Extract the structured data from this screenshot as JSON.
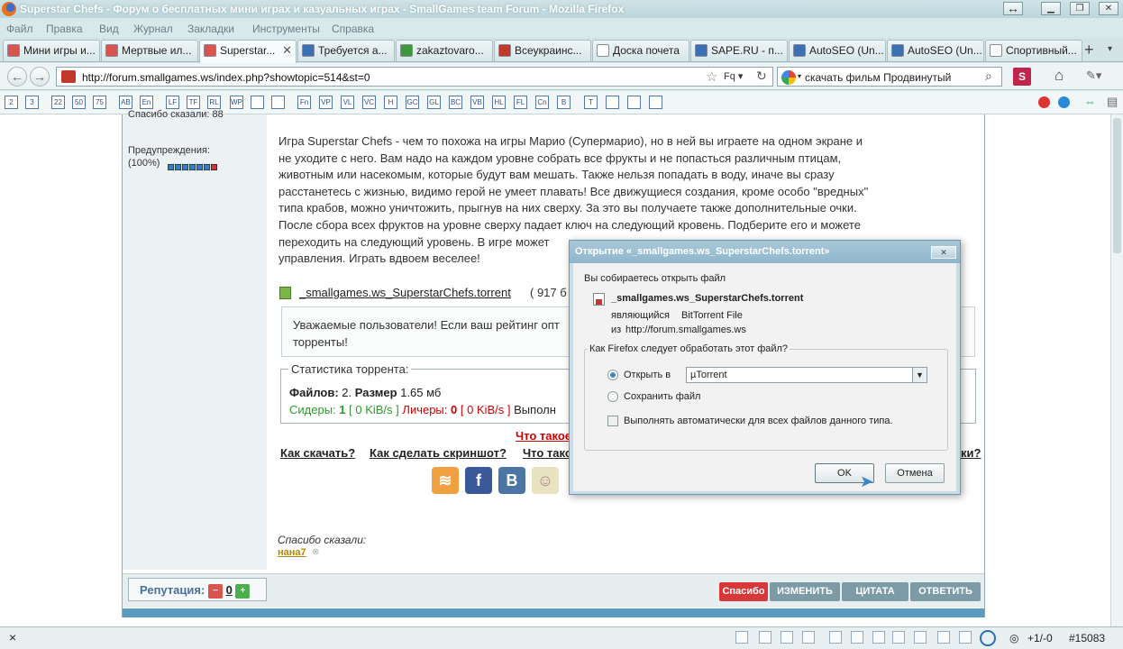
{
  "window": {
    "title": "Superstar Chefs - Форум о бесплатных мини играх и казуальных играх - SmallGames team Forum - Mozilla Firefox"
  },
  "menu": [
    "Файл",
    "Правка",
    "Вид",
    "Журнал",
    "Закладки",
    "Инструменты",
    "Справка"
  ],
  "tabs": [
    {
      "label": "Мини игры и...",
      "color": "#d9534f"
    },
    {
      "label": "Мертвые ил...",
      "color": "#d9534f"
    },
    {
      "label": "Superstar...",
      "color": "#d9534f",
      "active": true
    },
    {
      "label": "Требуется а...",
      "color": "#3b6fb6"
    },
    {
      "label": "zakaztovaro...",
      "color": "#3a9a3a"
    },
    {
      "label": "Всеукраинс...",
      "color": "#c0392b"
    },
    {
      "label": "Доска почета",
      "color": "#ffffff"
    },
    {
      "label": "SAPE.RU - п...",
      "color": "#3b6fb6"
    },
    {
      "label": "AutoSEO (Un...",
      "color": "#3b6fb6"
    },
    {
      "label": "AutoSEO (Un...",
      "color": "#3b6fb6"
    },
    {
      "label": "Спортивный...",
      "color": "#ffffff"
    }
  ],
  "nav": {
    "url": "http://forum.smallgames.ws/index.php?showtopic=514&st=0",
    "search": "скачать фильм Продвинутый"
  },
  "bbcodes": [
    "2",
    "3",
    "22",
    "50",
    "75",
    "AB",
    "En",
    "LF",
    "TF",
    "RL",
    "WP",
    "",
    "",
    "Fn",
    "VP",
    "VL",
    "VC",
    "H",
    "GC",
    "GL",
    "BC",
    "VB",
    "HL",
    "FL",
    "Cn",
    "B",
    "T",
    "",
    "",
    ""
  ],
  "sidebar": {
    "thanks_top": "Спасибо сказали: 88",
    "warn_label": "Предупреждения:",
    "warn_value": "(100%)"
  },
  "post": {
    "lines": [
      "Игра Superstar Chefs - чем то похожа на игры Марио (Супермарио), но в ней вы играете на одном экране и",
      "не уходите с него. Вам надо на каждом уровне собрать все фрукты и не попасться различным птицам,",
      "животным или насекомым, которые будут вам мешать. Также нельзя попадать в воду, иначе вы сразу",
      "расстанетесь с жизнью, видимо герой не умеет плавать! Все движущиеся создания, кроме особо \"вредных\"",
      "типа крабов, можно уничтожить, прыгнув на них сверху. За это вы получаете также дополнительные очки.",
      "После сбора всех фруктов на уровне сверху падает ключ на следующий кровень. Подберите его и можете",
      "переходить на следующий уровень. В игре может",
      "управления. Играть вдвоем веселее!"
    ],
    "attachment": "_smallgames.ws_SuperstarChefs.torrent",
    "attachment_size": "( 917 б",
    "notice_line1": "Уважаемые пользователи! Если ваш рейтинг опт",
    "notice_line2": "торренты!"
  },
  "stats": {
    "legend": "Статистика торрента:",
    "files_label": "Файлов:",
    "files_value": "2.",
    "size_label": "Размер",
    "size_value": "1.65 мб",
    "seeders_label": "Сидеры:",
    "seeders_value": "1",
    "seed_speed": "[ 0 KiB/s ]",
    "leechers_label": "Личеры:",
    "leechers_value": "0",
    "leech_speed": "[ 0 KiB/s ]",
    "extra": "Выполн"
  },
  "links": {
    "what": "Что такое",
    "how_download": "Как скачать?",
    "how_screenshot": "Как сделать скриншот?",
    "what2": "Что тако",
    "tail": "ки?"
  },
  "thanks": {
    "label": "Спасибо сказали:",
    "user": "нана7"
  },
  "footer": {
    "rep_label": "Репутация:",
    "rep_value": "0",
    "btn_thanks": "Спасибо",
    "btn_edit": "ИЗМЕНИТЬ",
    "btn_quote": "ЦИТАТА",
    "btn_reply": "ОТВЕТИТЬ"
  },
  "status": {
    "close": "×",
    "count": "+1/-0",
    "id": "#15083"
  },
  "dialog": {
    "title": "Открытие «_smallgames.ws_SuperstarChefs.torrent»",
    "intro": "Вы собираетесь открыть файл",
    "filename": "_smallgames.ws_SuperstarChefs.torrent",
    "type_label": "являющийся",
    "type_value": "BitTorrent File",
    "from_label": "из",
    "from_value": "http://forum.smallgames.ws",
    "question": "Как Firefox следует обработать этот файл?",
    "open_with": "Открыть в",
    "app": "µTorrent",
    "save": "Сохранить файл",
    "auto": "Выполнять автоматически для всех файлов данного типа.",
    "ok": "OK",
    "cancel": "Отмена"
  }
}
